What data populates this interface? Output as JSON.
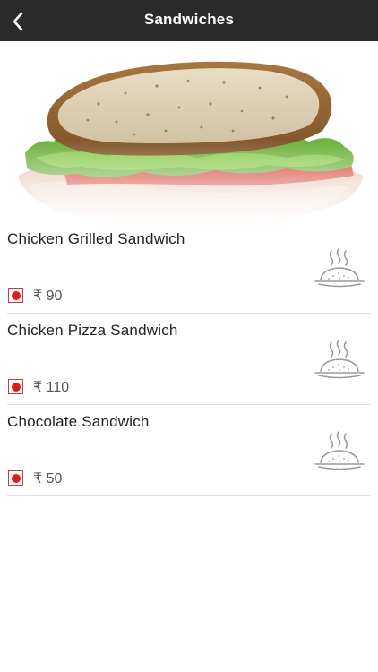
{
  "header": {
    "title": "Sandwiches",
    "back_icon": "chevron-left-icon"
  },
  "hero": {
    "image": "sandwich-photo"
  },
  "items": [
    {
      "name": "Chicken Grilled Sandwich",
      "price": "₹ 90",
      "diet_mark": "non-veg-indicator",
      "icon": "covered-dish-icon"
    },
    {
      "name": "Chicken Pizza Sandwich",
      "price": "₹ 110",
      "diet_mark": "non-veg-indicator",
      "icon": "covered-dish-icon"
    },
    {
      "name": "Chocolate Sandwich",
      "price": "₹ 50",
      "diet_mark": "non-veg-indicator",
      "icon": "covered-dish-icon"
    }
  ],
  "colors": {
    "topbar": "#2a2a2a",
    "diet_mark": "#e01b1b",
    "divider": "#e2e2e2"
  }
}
